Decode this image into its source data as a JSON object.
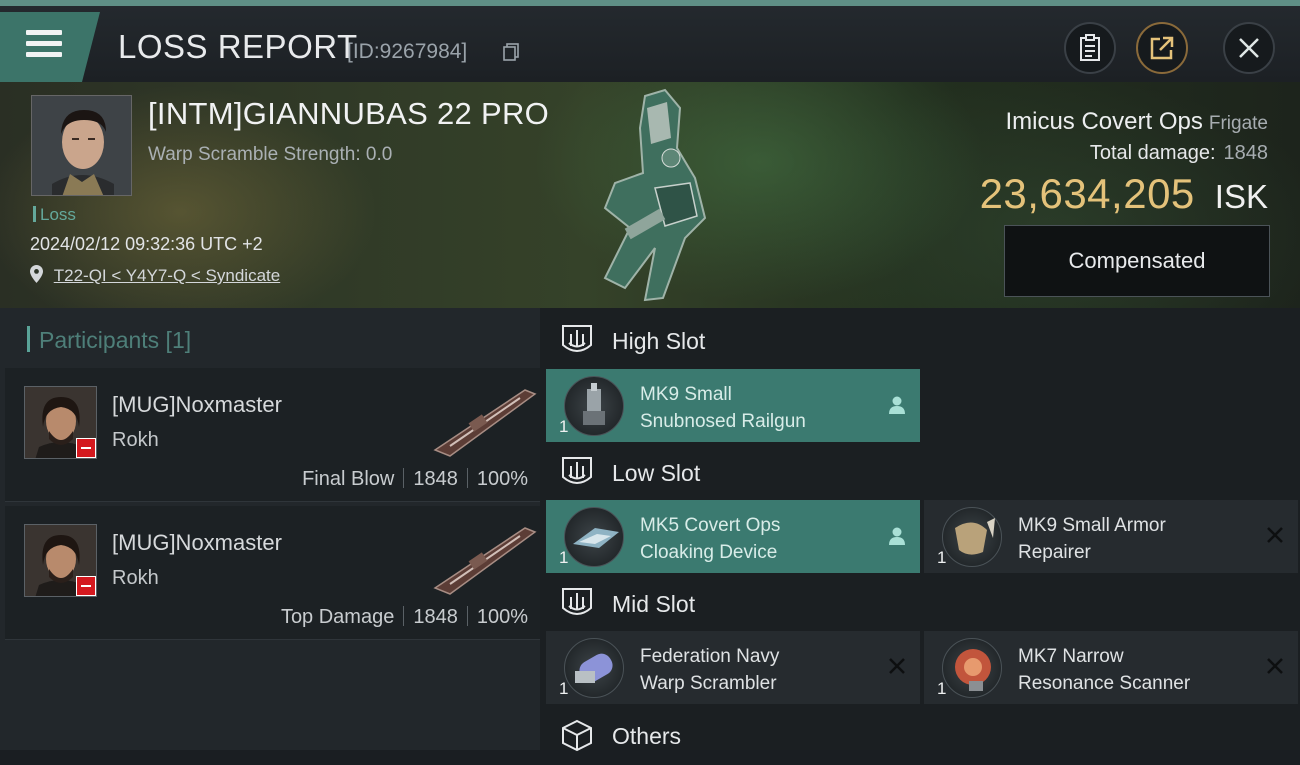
{
  "header": {
    "title": "LOSS REPORT",
    "id_text": "[ID:9267984]",
    "icons": [
      "menu-icon",
      "copy-icon",
      "clipboard-icon",
      "share-icon",
      "close-icon"
    ]
  },
  "victim": {
    "name": "[INTM]GIANNUBAS 22 PRO",
    "warp_scramble": "Warp Scramble Strength: 0.0",
    "status": "Loss",
    "timestamp": "2024/02/12 09:32:36 UTC +2",
    "location": "T22-QI < Y4Y7-Q < Syndicate"
  },
  "ship": {
    "name": "Imicus Covert Ops",
    "class": "Frigate",
    "total_damage_label": "Total damage:",
    "total_damage": "1848",
    "isk_value": "23,634,205",
    "isk_unit": "ISK",
    "compensated_label": "Compensated"
  },
  "participants": {
    "label": "Participants [1]",
    "rows": [
      {
        "name": "[MUG]Noxmaster",
        "ship": "Rokh",
        "role": "Final Blow",
        "damage": "1848",
        "percent": "100%"
      },
      {
        "name": "[MUG]Noxmaster",
        "ship": "Rokh",
        "role": "Top Damage",
        "damage": "1848",
        "percent": "100%"
      }
    ]
  },
  "slots": {
    "high": {
      "label": "High Slot",
      "modules": [
        {
          "line1": "MK9 Small",
          "line2": "Snubnosed Railgun",
          "qty": "1",
          "state": "fitted"
        }
      ]
    },
    "low": {
      "label": "Low Slot",
      "modules": [
        {
          "line1": "MK5 Covert Ops",
          "line2": "Cloaking Device",
          "qty": "1",
          "state": "fitted"
        },
        {
          "line1": "MK9 Small Armor",
          "line2": "Repairer",
          "qty": "1",
          "state": "destroyed"
        }
      ]
    },
    "mid": {
      "label": "Mid Slot",
      "modules": [
        {
          "line1": "Federation Navy",
          "line2": "Warp Scrambler",
          "qty": "1",
          "state": "destroyed"
        },
        {
          "line1": "MK7 Narrow",
          "line2": "Resonance Scanner",
          "qty": "1",
          "state": "destroyed"
        }
      ]
    },
    "others": {
      "label": "Others"
    }
  },
  "colors": {
    "accent": "#3b7a70",
    "isk": "#e4c27a",
    "loss_tag": "#64a89b",
    "flag": "#d4191f"
  }
}
